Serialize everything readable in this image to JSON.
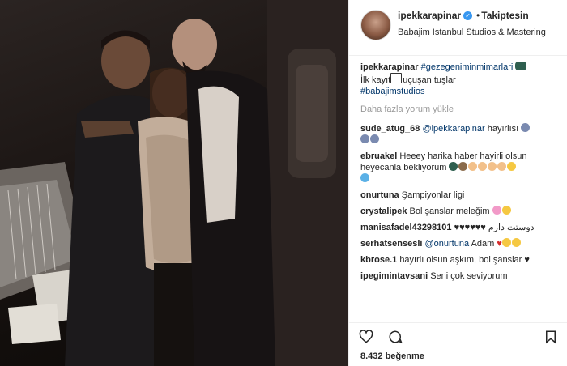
{
  "header": {
    "username": "ipekkarapinar",
    "follow_label": "Takiptesin",
    "location": "Babajim Istanbul Studios & Mastering"
  },
  "caption": {
    "username": "ipekkarapinar",
    "hashtag1": "#gezegeniminmimarlari",
    "line2": "İlk kayıt",
    "line2b": "uçuşan tuşlar",
    "hashtag2": "#babajimstudios"
  },
  "load_more": "Daha fazla yorum yükle",
  "comments": [
    {
      "user": "sude_atug_68",
      "mention": "@ipekkarapinar",
      "text": "hayırlısı"
    },
    {
      "user": "ebruakel",
      "text": "Heeey harika haber hayirli olsun heyecanla bekliyorum"
    },
    {
      "user": "onurtuna",
      "text": "Şampiyonlar ligi"
    },
    {
      "user": "crystalipek",
      "text": "Bol şanslar meleğim"
    },
    {
      "user": "manisafadel43298101",
      "text": "دوستت دارم"
    },
    {
      "user": "serhatsensesli",
      "mention": "@onurtuna",
      "text": "Adam"
    },
    {
      "user": "kbrose.1",
      "text": "hayırlı olsun aşkım, bol şanslar"
    },
    {
      "user": "ipegimintavsani",
      "text": "Seni çok seviyorum"
    }
  ],
  "likes": "8.432 beğenme",
  "colors": {
    "link": "#003569",
    "verified": "#3897f0",
    "heart": "#ed4956"
  }
}
